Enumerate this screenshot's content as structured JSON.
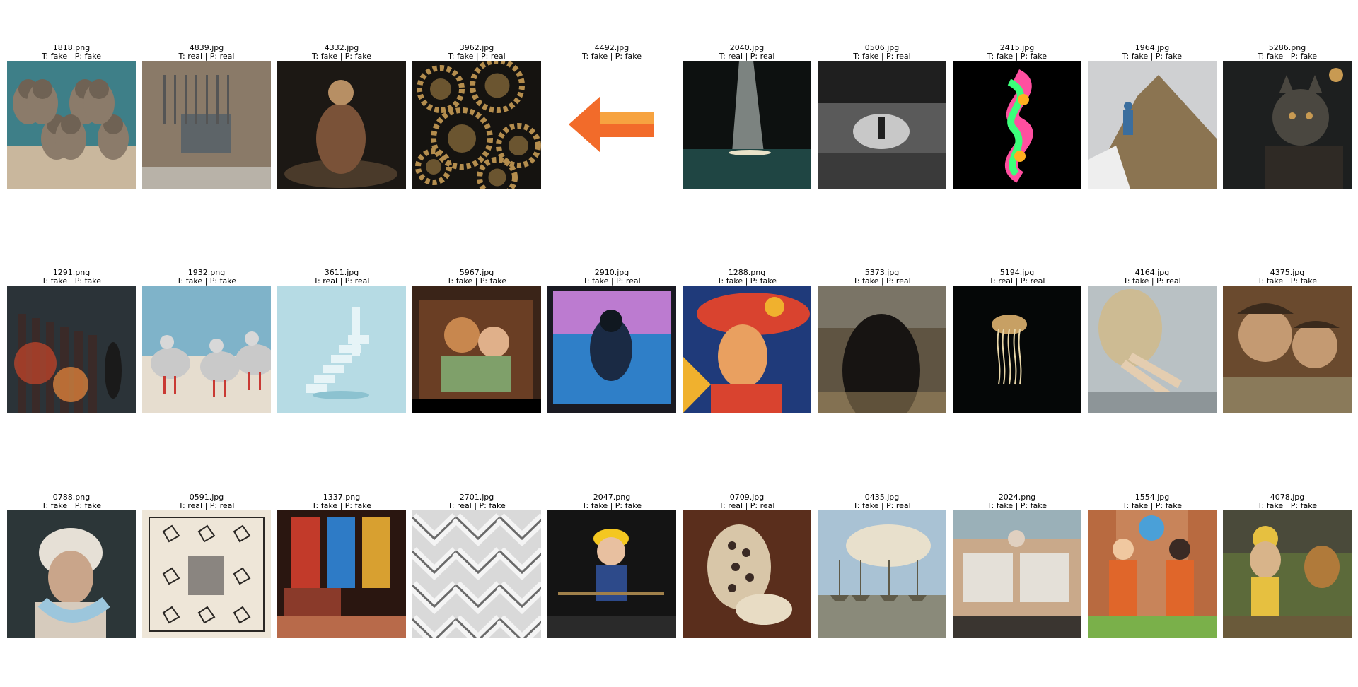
{
  "tiles": [
    {
      "file": "1818.png",
      "label": "T: fake | P: fake",
      "scene": "seals",
      "colors": [
        "#3e7f88",
        "#8b7b6a",
        "#c9b79d"
      ]
    },
    {
      "file": "4839.jpg",
      "label": "T: real | P: real",
      "scene": "wall-panel",
      "colors": [
        "#8a7a68",
        "#5d6468",
        "#b8b2a8"
      ]
    },
    {
      "file": "4332.jpg",
      "label": "T: fake | P: fake",
      "scene": "kneeling-person",
      "colors": [
        "#1c1814",
        "#7a5238",
        "#b78f64"
      ]
    },
    {
      "file": "3962.jpg",
      "label": "T: fake | P: real",
      "scene": "gears",
      "colors": [
        "#151310",
        "#6b5530",
        "#b48d4d"
      ]
    },
    {
      "file": "4492.jpg",
      "label": "T: fake | P: fake",
      "scene": "arrow-icon",
      "colors": [
        "#ffffff",
        "#f26b2a",
        "#f7a340"
      ]
    },
    {
      "file": "2040.jpg",
      "label": "T: real | P: real",
      "scene": "cave-light",
      "colors": [
        "#0d1110",
        "#1f4543",
        "#d8e2dc"
      ]
    },
    {
      "file": "0506.jpg",
      "label": "T: fake | P: real",
      "scene": "bw-sea",
      "colors": [
        "#1f1f1f",
        "#5a5a5a",
        "#c8c8c8"
      ]
    },
    {
      "file": "2415.jpg",
      "label": "T: fake | P: fake",
      "scene": "neon-swirl",
      "colors": [
        "#000000",
        "#ff4fa0",
        "#3cff7a"
      ]
    },
    {
      "file": "1964.jpg",
      "label": "T: fake | P: fake",
      "scene": "mountain-hiker",
      "colors": [
        "#cfd0d2",
        "#8b7451",
        "#3b6e9e"
      ]
    },
    {
      "file": "5286.png",
      "label": "T: fake | P: fake",
      "scene": "cat-portrait",
      "colors": [
        "#1d1f1f",
        "#4a4740",
        "#c89a52"
      ]
    },
    {
      "file": "1291.png",
      "label": "T: fake | P: fake",
      "scene": "burning-city",
      "colors": [
        "#2b3338",
        "#c9462a",
        "#f08a3c"
      ]
    },
    {
      "file": "1932.png",
      "label": "T: fake | P: fake",
      "scene": "birds-beach",
      "colors": [
        "#7fb3c9",
        "#e6ddcf",
        "#c93a34"
      ]
    },
    {
      "file": "3611.jpg",
      "label": "T: real | P: real",
      "scene": "stairs-3d",
      "colors": [
        "#b6dbe4",
        "#8cc2d0",
        "#e6f4f7"
      ]
    },
    {
      "file": "5967.jpg",
      "label": "T: fake | P: fake",
      "scene": "cartoon-room",
      "colors": [
        "#3a2418",
        "#c8874e",
        "#7fa06a"
      ]
    },
    {
      "file": "2910.jpg",
      "label": "T: fake | P: real",
      "scene": "abstract-figure",
      "colors": [
        "#1a1a22",
        "#e07bd2",
        "#2f7fc8"
      ]
    },
    {
      "file": "1288.png",
      "label": "T: fake | P: fake",
      "scene": "mosaic-woman",
      "colors": [
        "#1f3a7a",
        "#f0b12e",
        "#d9432f"
      ]
    },
    {
      "file": "5373.jpg",
      "label": "T: fake | P: real",
      "scene": "long-hair",
      "colors": [
        "#5f5442",
        "#a88d62",
        "#171412"
      ]
    },
    {
      "file": "5194.jpg",
      "label": "T: real | P: real",
      "scene": "jellyfish",
      "colors": [
        "#050707",
        "#c7a064",
        "#e8d6a8"
      ]
    },
    {
      "file": "4164.jpg",
      "label": "T: fake | P: real",
      "scene": "legs-water",
      "colors": [
        "#b9c1c4",
        "#cdbb93",
        "#8d9598"
      ]
    },
    {
      "file": "4375.jpg",
      "label": "T: fake | P: fake",
      "scene": "laughing-kids",
      "colors": [
        "#6a4a2e",
        "#c49a72",
        "#3a2a1c"
      ]
    },
    {
      "file": "0788.png",
      "label": "T: fake | P: fake",
      "scene": "old-woman",
      "colors": [
        "#2c3638",
        "#d6cbbd",
        "#9cc6dc"
      ]
    },
    {
      "file": "0591.jpg",
      "label": "T: real | P: real",
      "scene": "sketch-sheet",
      "colors": [
        "#eee6d8",
        "#2a2724",
        "#8a8580"
      ]
    },
    {
      "file": "1337.png",
      "label": "T: fake | P: fake",
      "scene": "stained-glass",
      "colors": [
        "#2a1610",
        "#c23a2a",
        "#2e7bc6"
      ]
    },
    {
      "file": "2701.jpg",
      "label": "T: real | P: fake",
      "scene": "chevron-pattern",
      "colors": [
        "#d9d9d9",
        "#f4f4f4",
        "#6a6a6a"
      ]
    },
    {
      "file": "2047.png",
      "label": "T: fake | P: fake",
      "scene": "child-miner",
      "colors": [
        "#141414",
        "#f4c720",
        "#2d4a8a"
      ]
    },
    {
      "file": "0709.jpg",
      "label": "T: real | P: real",
      "scene": "still-life",
      "colors": [
        "#5a2e1c",
        "#d8c6a8",
        "#8a4a2a"
      ]
    },
    {
      "file": "0435.jpg",
      "label": "T: fake | P: real",
      "scene": "harbor-ships",
      "colors": [
        "#a9c2d4",
        "#e8e0cc",
        "#5f5a48"
      ]
    },
    {
      "file": "2024.png",
      "label": "T: fake | P: fake",
      "scene": "beach-pods",
      "colors": [
        "#c9a98a",
        "#e4e0d8",
        "#3a3530"
      ]
    },
    {
      "file": "1554.jpg",
      "label": "T: fake | P: fake",
      "scene": "cartoon-handshake",
      "colors": [
        "#c8845a",
        "#e0662a",
        "#4aa0d8"
      ]
    },
    {
      "file": "4078.jpg",
      "label": "T: fake | P: fake",
      "scene": "dogs-workers",
      "colors": [
        "#5c6a3a",
        "#e6c040",
        "#b07a3a"
      ]
    }
  ]
}
